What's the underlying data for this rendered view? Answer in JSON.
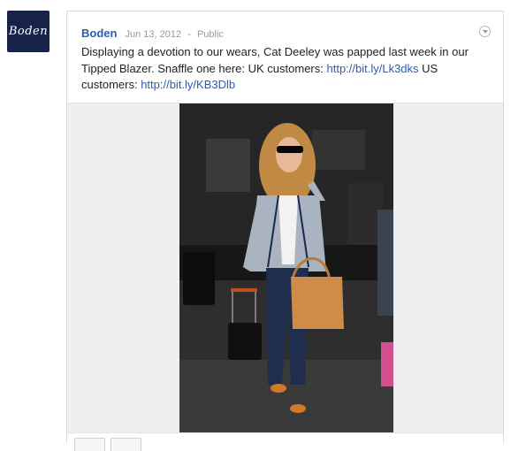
{
  "author": {
    "name": "Boden",
    "avatar_text": "Boden",
    "avatar_color": "#16224a"
  },
  "post": {
    "date": "Jun 13, 2012",
    "separator": "-",
    "visibility": "Public",
    "text_part1": "Displaying a devotion to our wears, Cat Deeley was papped last week in our Tipped Blazer. Snaffle one here: UK customers: ",
    "link_uk": "http://bit.ly/Lk3dks",
    "text_part2": " US customers: ",
    "link_us": "http://bit.ly/KB3Dlb",
    "menu_icon": "chevron-down-circle-icon"
  },
  "colors": {
    "link": "#2a5db0",
    "text": "#222222",
    "meta": "#9a9a9a"
  }
}
